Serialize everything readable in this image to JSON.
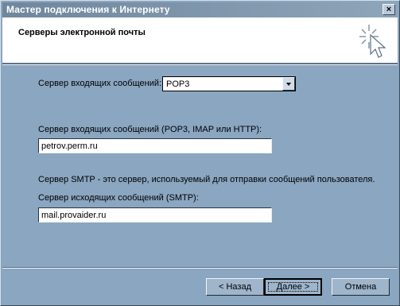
{
  "window": {
    "title": "Мастер подключения к Интернету",
    "close_label": "×"
  },
  "header": {
    "title": "Серверы электронной почты",
    "icon": "wizard-sparkle-cursor-icon"
  },
  "form": {
    "server_type_label": "Сервер входящих сообщений:",
    "server_type_value": "POP3",
    "incoming_label": "Сервер входящих сообщений (POP3, IMAP или HTTP):",
    "incoming_value": "petrov.perm.ru",
    "smtp_note": "Сервер SMTP - это сервер, используемый для отправки сообщений  пользователя.",
    "outgoing_label": "Сервер исходящих сообщений (SMTP):",
    "outgoing_value": "mail.provaider.ru"
  },
  "buttons": {
    "back": "< Назад",
    "next": "Далее >",
    "cancel": "Отмена"
  }
}
